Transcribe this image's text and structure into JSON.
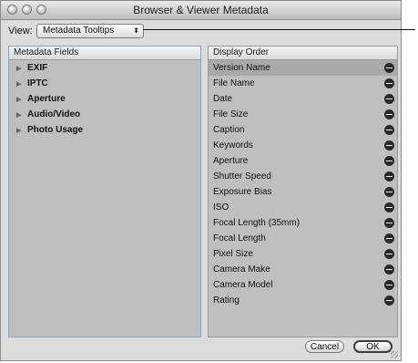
{
  "window": {
    "title": "Browser & Viewer Metadata"
  },
  "view": {
    "label": "View:",
    "selected": "Metadata Tooltips",
    "arrows_glyph": "⬍"
  },
  "metadata_fields": {
    "header": "Metadata Fields",
    "items": [
      "EXIF",
      "IPTC",
      "Aperture",
      "Audio/Video",
      "Photo Usage"
    ]
  },
  "display_order": {
    "header": "Display Order",
    "selected_index": 0,
    "items": [
      "Version Name",
      "File Name",
      "Date",
      "File Size",
      "Caption",
      "Keywords",
      "Aperture",
      "Shutter Speed",
      "Exposure Bias",
      "ISO",
      "Focal Length (35mm)",
      "Focal Length",
      "Pixel Size",
      "Camera Make",
      "Camera Model",
      "Rating"
    ]
  },
  "buttons": {
    "cancel": "Cancel",
    "ok": "OK"
  },
  "icons": {
    "disclosure": "disclosure-triangle-icon",
    "remove": "remove-minus-icon"
  }
}
